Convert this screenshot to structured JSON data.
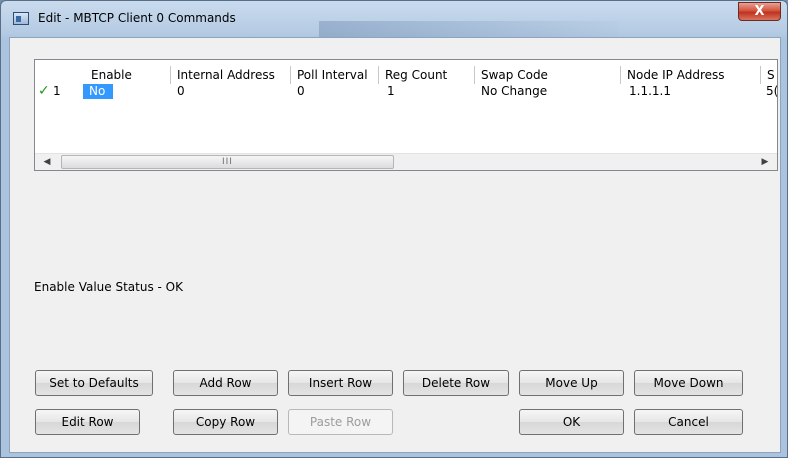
{
  "window": {
    "title": "Edit - MBTCP Client 0 Commands",
    "close_label": "X"
  },
  "table": {
    "columns": [
      "Enable",
      "Internal Address",
      "Poll Interval",
      "Reg Count",
      "Swap Code",
      "Node IP Address",
      "S"
    ],
    "rows": [
      {
        "status": "✓",
        "number": "1",
        "enable": "No",
        "internal_address": "0",
        "poll_interval": "0",
        "reg_count": "1",
        "swap_code": "No Change",
        "node_ip": "1.1.1.1",
        "truncated": "5("
      }
    ],
    "scroll_left": "◀",
    "scroll_right": "▶",
    "scroll_grip": "III"
  },
  "status_text": "Enable Value Status - OK",
  "buttons": {
    "set_defaults": "Set to Defaults",
    "add_row": "Add Row",
    "insert_row": "Insert Row",
    "delete_row": "Delete Row",
    "move_up": "Move Up",
    "move_down": "Move Down",
    "edit_row": "Edit Row",
    "copy_row": "Copy Row",
    "paste_row": "Paste Row",
    "ok": "OK",
    "cancel": "Cancel"
  }
}
